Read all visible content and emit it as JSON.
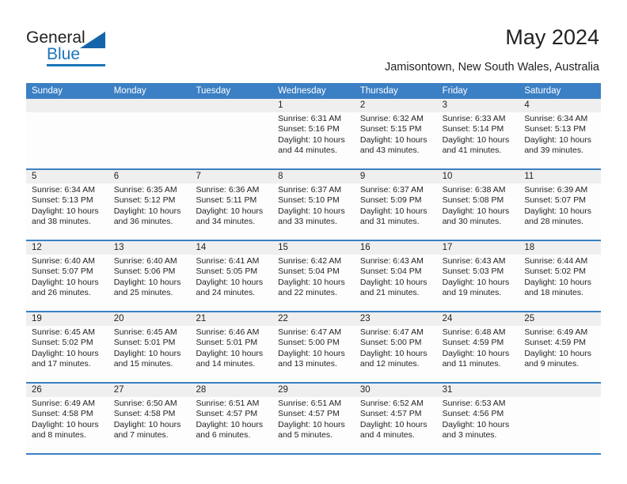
{
  "brand": {
    "name_part1": "General",
    "name_part2": "Blue"
  },
  "header": {
    "title": "May 2024",
    "subtitle": "Jamisontown, New South Wales, Australia"
  },
  "colors": {
    "header_blue": "#3b7fc4",
    "brand_blue": "#1b75bb",
    "daynum_band": "#efefef",
    "text": "#231f20"
  },
  "weekdays": [
    "Sunday",
    "Monday",
    "Tuesday",
    "Wednesday",
    "Thursday",
    "Friday",
    "Saturday"
  ],
  "weeks": [
    {
      "days": [
        {
          "num": "",
          "lines": []
        },
        {
          "num": "",
          "lines": []
        },
        {
          "num": "",
          "lines": []
        },
        {
          "num": "1",
          "lines": [
            "Sunrise: 6:31 AM",
            "Sunset: 5:16 PM",
            "Daylight: 10 hours",
            "and 44 minutes."
          ]
        },
        {
          "num": "2",
          "lines": [
            "Sunrise: 6:32 AM",
            "Sunset: 5:15 PM",
            "Daylight: 10 hours",
            "and 43 minutes."
          ]
        },
        {
          "num": "3",
          "lines": [
            "Sunrise: 6:33 AM",
            "Sunset: 5:14 PM",
            "Daylight: 10 hours",
            "and 41 minutes."
          ]
        },
        {
          "num": "4",
          "lines": [
            "Sunrise: 6:34 AM",
            "Sunset: 5:13 PM",
            "Daylight: 10 hours",
            "and 39 minutes."
          ]
        }
      ]
    },
    {
      "days": [
        {
          "num": "5",
          "lines": [
            "Sunrise: 6:34 AM",
            "Sunset: 5:13 PM",
            "Daylight: 10 hours",
            "and 38 minutes."
          ]
        },
        {
          "num": "6",
          "lines": [
            "Sunrise: 6:35 AM",
            "Sunset: 5:12 PM",
            "Daylight: 10 hours",
            "and 36 minutes."
          ]
        },
        {
          "num": "7",
          "lines": [
            "Sunrise: 6:36 AM",
            "Sunset: 5:11 PM",
            "Daylight: 10 hours",
            "and 34 minutes."
          ]
        },
        {
          "num": "8",
          "lines": [
            "Sunrise: 6:37 AM",
            "Sunset: 5:10 PM",
            "Daylight: 10 hours",
            "and 33 minutes."
          ]
        },
        {
          "num": "9",
          "lines": [
            "Sunrise: 6:37 AM",
            "Sunset: 5:09 PM",
            "Daylight: 10 hours",
            "and 31 minutes."
          ]
        },
        {
          "num": "10",
          "lines": [
            "Sunrise: 6:38 AM",
            "Sunset: 5:08 PM",
            "Daylight: 10 hours",
            "and 30 minutes."
          ]
        },
        {
          "num": "11",
          "lines": [
            "Sunrise: 6:39 AM",
            "Sunset: 5:07 PM",
            "Daylight: 10 hours",
            "and 28 minutes."
          ]
        }
      ]
    },
    {
      "days": [
        {
          "num": "12",
          "lines": [
            "Sunrise: 6:40 AM",
            "Sunset: 5:07 PM",
            "Daylight: 10 hours",
            "and 26 minutes."
          ]
        },
        {
          "num": "13",
          "lines": [
            "Sunrise: 6:40 AM",
            "Sunset: 5:06 PM",
            "Daylight: 10 hours",
            "and 25 minutes."
          ]
        },
        {
          "num": "14",
          "lines": [
            "Sunrise: 6:41 AM",
            "Sunset: 5:05 PM",
            "Daylight: 10 hours",
            "and 24 minutes."
          ]
        },
        {
          "num": "15",
          "lines": [
            "Sunrise: 6:42 AM",
            "Sunset: 5:04 PM",
            "Daylight: 10 hours",
            "and 22 minutes."
          ]
        },
        {
          "num": "16",
          "lines": [
            "Sunrise: 6:43 AM",
            "Sunset: 5:04 PM",
            "Daylight: 10 hours",
            "and 21 minutes."
          ]
        },
        {
          "num": "17",
          "lines": [
            "Sunrise: 6:43 AM",
            "Sunset: 5:03 PM",
            "Daylight: 10 hours",
            "and 19 minutes."
          ]
        },
        {
          "num": "18",
          "lines": [
            "Sunrise: 6:44 AM",
            "Sunset: 5:02 PM",
            "Daylight: 10 hours",
            "and 18 minutes."
          ]
        }
      ]
    },
    {
      "days": [
        {
          "num": "19",
          "lines": [
            "Sunrise: 6:45 AM",
            "Sunset: 5:02 PM",
            "Daylight: 10 hours",
            "and 17 minutes."
          ]
        },
        {
          "num": "20",
          "lines": [
            "Sunrise: 6:45 AM",
            "Sunset: 5:01 PM",
            "Daylight: 10 hours",
            "and 15 minutes."
          ]
        },
        {
          "num": "21",
          "lines": [
            "Sunrise: 6:46 AM",
            "Sunset: 5:01 PM",
            "Daylight: 10 hours",
            "and 14 minutes."
          ]
        },
        {
          "num": "22",
          "lines": [
            "Sunrise: 6:47 AM",
            "Sunset: 5:00 PM",
            "Daylight: 10 hours",
            "and 13 minutes."
          ]
        },
        {
          "num": "23",
          "lines": [
            "Sunrise: 6:47 AM",
            "Sunset: 5:00 PM",
            "Daylight: 10 hours",
            "and 12 minutes."
          ]
        },
        {
          "num": "24",
          "lines": [
            "Sunrise: 6:48 AM",
            "Sunset: 4:59 PM",
            "Daylight: 10 hours",
            "and 11 minutes."
          ]
        },
        {
          "num": "25",
          "lines": [
            "Sunrise: 6:49 AM",
            "Sunset: 4:59 PM",
            "Daylight: 10 hours",
            "and 9 minutes."
          ]
        }
      ]
    },
    {
      "days": [
        {
          "num": "26",
          "lines": [
            "Sunrise: 6:49 AM",
            "Sunset: 4:58 PM",
            "Daylight: 10 hours",
            "and 8 minutes."
          ]
        },
        {
          "num": "27",
          "lines": [
            "Sunrise: 6:50 AM",
            "Sunset: 4:58 PM",
            "Daylight: 10 hours",
            "and 7 minutes."
          ]
        },
        {
          "num": "28",
          "lines": [
            "Sunrise: 6:51 AM",
            "Sunset: 4:57 PM",
            "Daylight: 10 hours",
            "and 6 minutes."
          ]
        },
        {
          "num": "29",
          "lines": [
            "Sunrise: 6:51 AM",
            "Sunset: 4:57 PM",
            "Daylight: 10 hours",
            "and 5 minutes."
          ]
        },
        {
          "num": "30",
          "lines": [
            "Sunrise: 6:52 AM",
            "Sunset: 4:57 PM",
            "Daylight: 10 hours",
            "and 4 minutes."
          ]
        },
        {
          "num": "31",
          "lines": [
            "Sunrise: 6:53 AM",
            "Sunset: 4:56 PM",
            "Daylight: 10 hours",
            "and 3 minutes."
          ]
        },
        {
          "num": "",
          "lines": []
        }
      ]
    }
  ]
}
